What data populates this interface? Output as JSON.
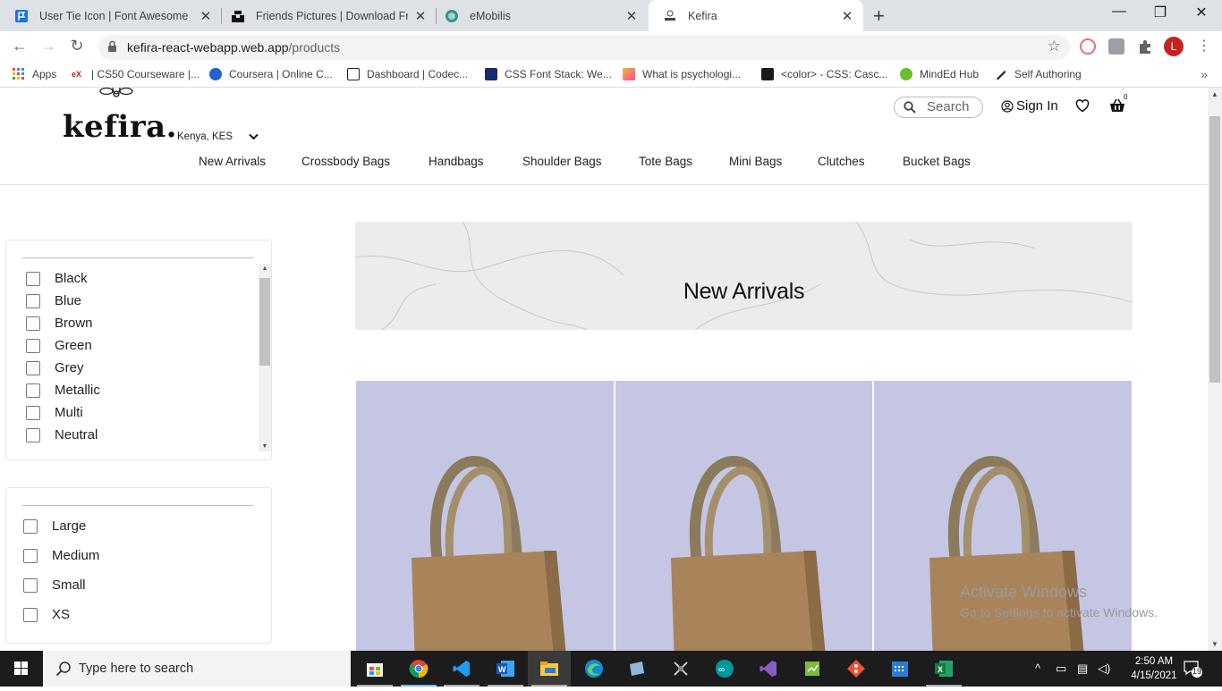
{
  "browser": {
    "tabs": [
      {
        "title": "User Tie Icon | Font Awesome",
        "icon": "font-awesome-flag-icon",
        "color": "#1a73e8"
      },
      {
        "title": "Friends Pictures | Download Free",
        "icon": "unsplash-icon",
        "color": "#111111"
      },
      {
        "title": "eMobilis",
        "icon": "emobilis-icon",
        "color": "#3a8f8f"
      },
      {
        "title": "Kefira",
        "icon": "kefira-icon",
        "active": true
      }
    ],
    "url_host": "kefira-react-webapp.web.app",
    "url_path": "/products",
    "bookmarks": [
      "Apps",
      "| CS50 Courseware |...",
      "Coursera | Online C...",
      "Dashboard | Codec...",
      "CSS Font Stack: We...",
      "What is psychologi...",
      "<color> - CSS: Casc...",
      "MindEd Hub",
      "Self Authoring"
    ],
    "profile_initial": "L"
  },
  "site": {
    "logo": "kefira.",
    "currency": "Kenya, KES",
    "search_placeholder": "Search",
    "signin": "Sign In",
    "cart_count": "0",
    "nav": [
      "New Arrivals",
      "Crossbody Bags",
      "Handbags",
      "Shoulder Bags",
      "Tote Bags",
      "Mini Bags",
      "Clutches",
      "Bucket Bags"
    ],
    "color_filters": [
      "Black",
      "Blue",
      "Brown",
      "Green",
      "Grey",
      "Metallic",
      "Multi",
      "Neutral"
    ],
    "size_filters": [
      "Large",
      "Medium",
      "Small",
      "XS"
    ],
    "banner_title": "New Arrivals",
    "product_bg": "#c4c6e4"
  },
  "watermark": {
    "title": "Activate Windows",
    "subtitle": "Go to Settings to activate Windows."
  },
  "taskbar": {
    "search_placeholder": "Type here to search",
    "time": "2:50 AM",
    "date": "4/15/2021",
    "notifications": "19"
  }
}
